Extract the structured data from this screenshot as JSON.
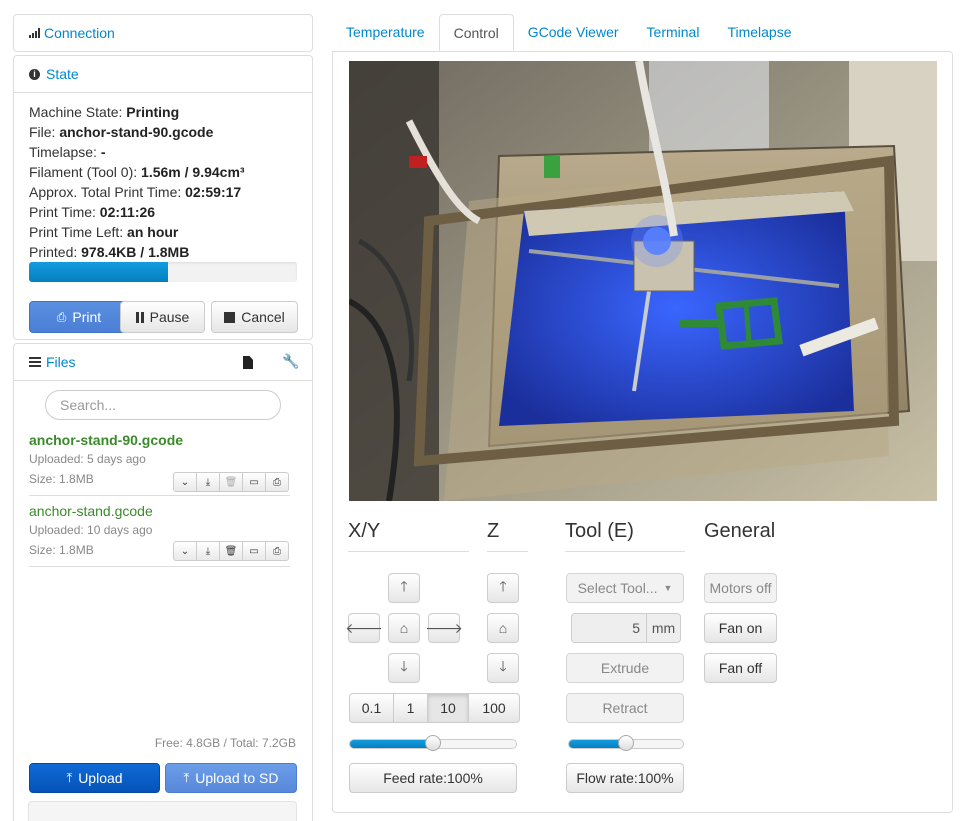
{
  "sidebar": {
    "connection": {
      "title": "Connection",
      "icon": "signal-icon"
    },
    "state": {
      "title": "State",
      "icon": "info-circle-icon",
      "lines": [
        {
          "label": "Machine State: ",
          "value": "Printing"
        },
        {
          "label": "File: ",
          "value": "anchor-stand-90.gcode"
        },
        {
          "label": "Timelapse: ",
          "value": "-"
        },
        {
          "label": "Filament (Tool 0): ",
          "value": "1.56m / 9.94cm³"
        },
        {
          "label": "Approx. Total Print Time: ",
          "value": "02:59:17"
        },
        {
          "label": "Print Time: ",
          "value": "02:11:26"
        },
        {
          "label": "Print Time Left: ",
          "value": "an hour"
        },
        {
          "label": "Printed: ",
          "value": "978.4KB / 1.8MB"
        }
      ],
      "progress_fraction": 0.52,
      "buttons": {
        "print": "Print",
        "pause": "Pause",
        "cancel": "Cancel"
      }
    },
    "files": {
      "title": "Files",
      "search_placeholder": "Search...",
      "items": [
        {
          "name": "anchor-stand-90.gcode",
          "uploaded": "Uploaded: 5 days ago",
          "size": "Size: 1.8MB",
          "selected": true
        },
        {
          "name": "anchor-stand.gcode",
          "uploaded": "Uploaded: 10 days ago",
          "size": "Size: 1.8MB",
          "selected": false
        }
      ],
      "storage": "Free: 4.8GB / Total: 7.2GB",
      "upload_label": "Upload",
      "upload_sd_label": "Upload to SD"
    }
  },
  "tabs": [
    "Temperature",
    "Control",
    "GCode Viewer",
    "Terminal",
    "Timelapse"
  ],
  "active_tab": "Control",
  "control": {
    "xy_title": "X/Y",
    "z_title": "Z",
    "tool_title": "Tool (E)",
    "general_title": "General",
    "step_options": [
      "0.1",
      "1",
      "10",
      "100"
    ],
    "active_step": "10",
    "feed_rate_label": "Feed rate:100%",
    "feed_rate_fraction": 0.5,
    "flow_rate_label": "Flow rate:100%",
    "flow_rate_fraction": 0.5,
    "select_tool_label": "Select Tool...",
    "extrude_amount": "5",
    "extrude_unit": "mm",
    "extrude_label": "Extrude",
    "retract_label": "Retract",
    "motors_off_label": "Motors off",
    "fan_on_label": "Fan on",
    "fan_off_label": "Fan off"
  },
  "colors": {
    "accent": "#0088cc",
    "primary_button": "#4a7fd6",
    "upload_button": "#0553b8",
    "file_selected": "#3a8a2a",
    "progress": "#0480be"
  }
}
